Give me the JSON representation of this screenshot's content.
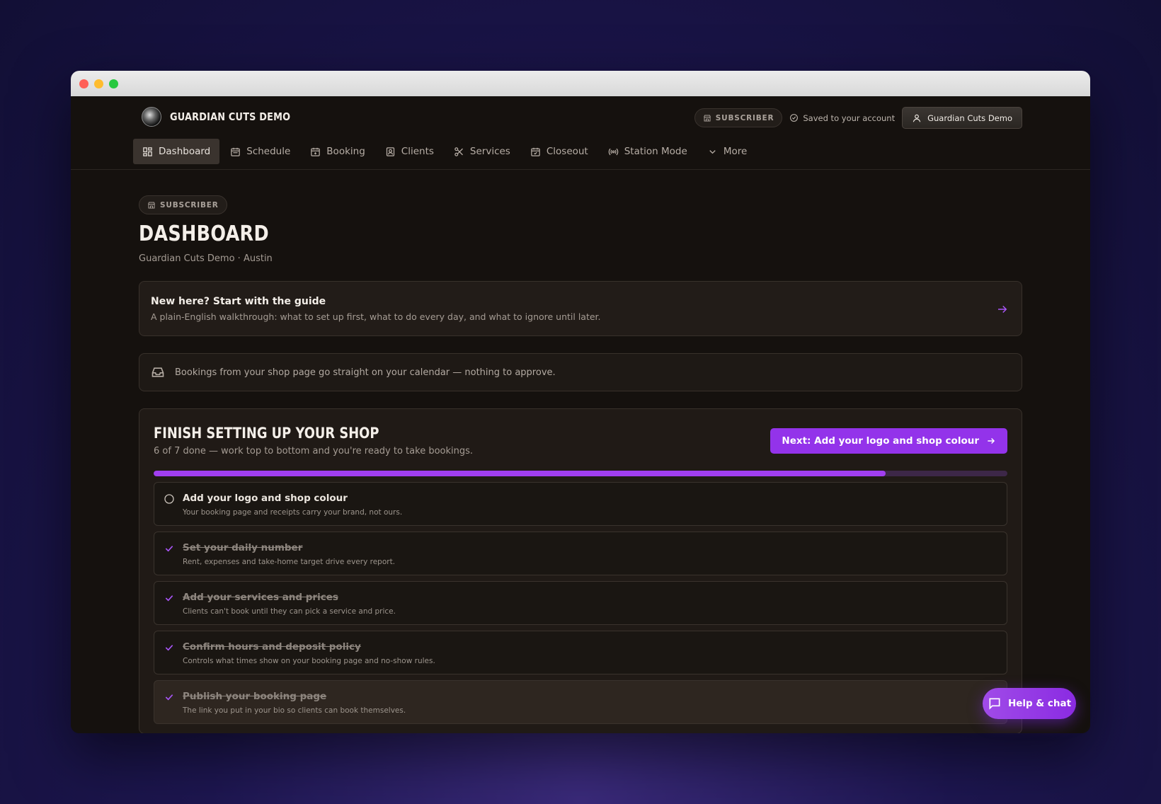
{
  "app": {
    "brand_name": "GUARDIAN CUTS DEMO",
    "subscriber_badge": "SUBSCRIBER",
    "saved_status": "Saved to your account",
    "account_name": "Guardian Cuts Demo"
  },
  "nav": {
    "items": [
      {
        "label": "Dashboard",
        "icon": "grid-icon"
      },
      {
        "label": "Schedule",
        "icon": "calendar-icon"
      },
      {
        "label": "Booking",
        "icon": "calendar-plus-icon"
      },
      {
        "label": "Clients",
        "icon": "contact-icon"
      },
      {
        "label": "Services",
        "icon": "scissors-icon"
      },
      {
        "label": "Closeout",
        "icon": "calendar-check-icon"
      },
      {
        "label": "Station Mode",
        "icon": "broadcast-icon"
      },
      {
        "label": "More",
        "icon": "chevron-down-icon"
      }
    ]
  },
  "page": {
    "badge": "SUBSCRIBER",
    "title": "DASHBOARD",
    "subtitle": "Guardian Cuts Demo · Austin"
  },
  "guide": {
    "title": "New here? Start with the guide",
    "description": "A plain-English walkthrough: what to set up first, what to do every day, and what to ignore until later."
  },
  "notice": {
    "text": "Bookings from your shop page go straight on your calendar — nothing to approve."
  },
  "setup": {
    "title": "FINISH SETTING UP YOUR SHOP",
    "subtitle": "6 of 7 done — work top to bottom and you're ready to take bookings.",
    "next_button": "Next: Add your logo and shop colour",
    "progress_fraction": 0.857,
    "tasks": [
      {
        "title": "Add your logo and shop colour",
        "description": "Your booking page and receipts carry your brand, not ours.",
        "done": false
      },
      {
        "title": "Set your daily number",
        "description": "Rent, expenses and take-home target drive every report.",
        "done": true
      },
      {
        "title": "Add your services and prices",
        "description": "Clients can't book until they can pick a service and price.",
        "done": true
      },
      {
        "title": "Confirm hours and deposit policy",
        "description": "Controls what times show on your booking page and no-show rules.",
        "done": true
      },
      {
        "title": "Publish your booking page",
        "description": "The link you put in your bio so clients can book themselves.",
        "done": true
      }
    ]
  },
  "help": {
    "label": "Help & chat"
  },
  "colors": {
    "accent": "#9333ea",
    "background": "#15110e"
  }
}
